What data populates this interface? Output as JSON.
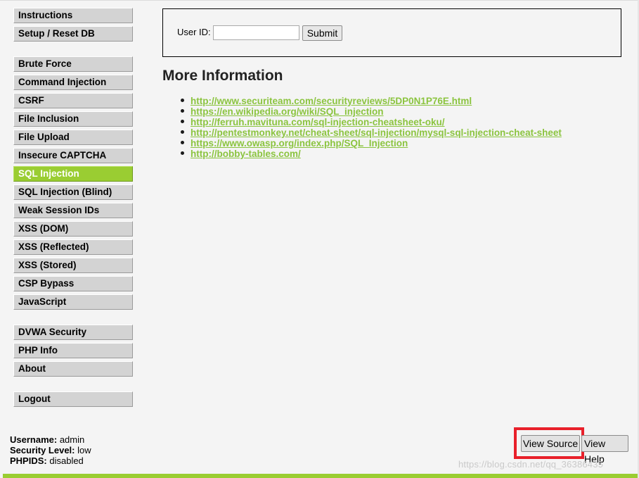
{
  "sidebar": {
    "groups": [
      {
        "items": [
          {
            "label": "Instructions"
          },
          {
            "label": "Setup / Reset DB"
          }
        ]
      },
      {
        "items": [
          {
            "label": "Brute Force"
          },
          {
            "label": "Command Injection"
          },
          {
            "label": "CSRF"
          },
          {
            "label": "File Inclusion"
          },
          {
            "label": "File Upload"
          },
          {
            "label": "Insecure CAPTCHA"
          },
          {
            "label": "SQL Injection",
            "selected": true
          },
          {
            "label": "SQL Injection (Blind)"
          },
          {
            "label": "Weak Session IDs"
          },
          {
            "label": "XSS (DOM)"
          },
          {
            "label": "XSS (Reflected)"
          },
          {
            "label": "XSS (Stored)"
          },
          {
            "label": "CSP Bypass"
          },
          {
            "label": "JavaScript"
          }
        ]
      },
      {
        "items": [
          {
            "label": "DVWA Security"
          },
          {
            "label": "PHP Info"
          },
          {
            "label": "About"
          }
        ]
      },
      {
        "items": [
          {
            "label": "Logout"
          }
        ]
      }
    ]
  },
  "form": {
    "user_id_label": "User ID:",
    "user_id_value": "",
    "submit_label": "Submit"
  },
  "more_info": {
    "heading": "More Information",
    "links": [
      "http://www.securiteam.com/securityreviews/5DP0N1P76E.html",
      "https://en.wikipedia.org/wiki/SQL_injection",
      "http://ferruh.mavituna.com/sql-injection-cheatsheet-oku/",
      "http://pentestmonkey.net/cheat-sheet/sql-injection/mysql-sql-injection-cheat-sheet",
      "https://www.owasp.org/index.php/SQL_Injection",
      "http://bobby-tables.com/"
    ]
  },
  "status": {
    "username_label": "Username:",
    "username_value": "admin",
    "security_label": "Security Level:",
    "security_value": "low",
    "phpids_label": "PHPIDS:",
    "phpids_value": "disabled"
  },
  "buttons": {
    "view_source": "View Source",
    "view_help": "View Help"
  },
  "watermark": "https://blog.csdn.net/qq_36386435",
  "colors": {
    "accent_green": "#9acd32",
    "link_green": "#8bc43f",
    "highlight_red": "#e8202a",
    "menu_grey": "#d3d3d3"
  }
}
